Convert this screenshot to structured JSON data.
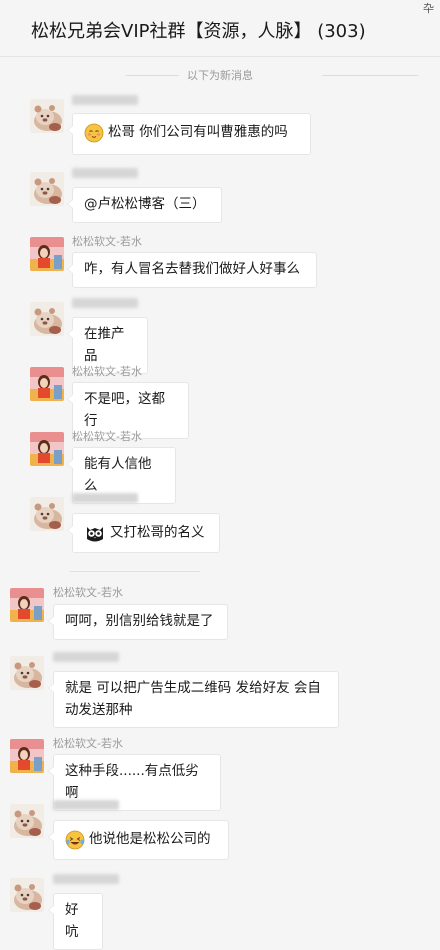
{
  "window": {
    "title": "松松兄弟会VIP社群【资源，人脉】 (303)",
    "corner_glyph": "卆"
  },
  "divider": {
    "text": "以下为新消息"
  },
  "messages": [
    {
      "sender": "",
      "sender_blurred": true,
      "avatar": "bear",
      "emoji": "shy-face",
      "text": "松哥 你们公司有叫曹雅惠的吗"
    },
    {
      "sender": "",
      "sender_blurred": true,
      "avatar": "bear",
      "emoji": "",
      "text": "@卢松松博客（三）"
    },
    {
      "sender": "松松软文-若水",
      "sender_blurred": false,
      "avatar": "girl",
      "emoji": "",
      "text": "咋，有人冒名去替我们做好人好事么"
    },
    {
      "sender": "",
      "sender_blurred": true,
      "avatar": "bear",
      "emoji": "",
      "text": "在推产品"
    },
    {
      "sender": "松松软文-若水",
      "sender_blurred": false,
      "avatar": "girl",
      "emoji": "",
      "text": "不是吧，这都行"
    },
    {
      "sender": "松松软文-若水",
      "sender_blurred": false,
      "avatar": "girl",
      "emoji": "",
      "text": "能有人信他么"
    },
    {
      "sender": "",
      "sender_blurred": true,
      "avatar": "bear",
      "emoji": "owl-face",
      "text": "又打松哥的名义"
    },
    {
      "sender": "松松软文-若水",
      "sender_blurred": false,
      "avatar": "girl",
      "emoji": "",
      "text": "呵呵，别信别给钱就是了"
    },
    {
      "sender": "",
      "sender_blurred": true,
      "avatar": "bear",
      "emoji": "",
      "text": "就是 可以把广告生成二维码 发给好友 会自动发送那种"
    },
    {
      "sender": "松松软文-若水",
      "sender_blurred": false,
      "avatar": "girl",
      "emoji": "",
      "text": "这种手段......有点低劣啊"
    },
    {
      "sender": "",
      "sender_blurred": true,
      "avatar": "bear",
      "emoji": "laugh-cry-face",
      "text": "他说他是松松公司的"
    },
    {
      "sender": "",
      "sender_blurred": true,
      "avatar": "bear",
      "emoji": "",
      "text": "好吭"
    }
  ]
}
